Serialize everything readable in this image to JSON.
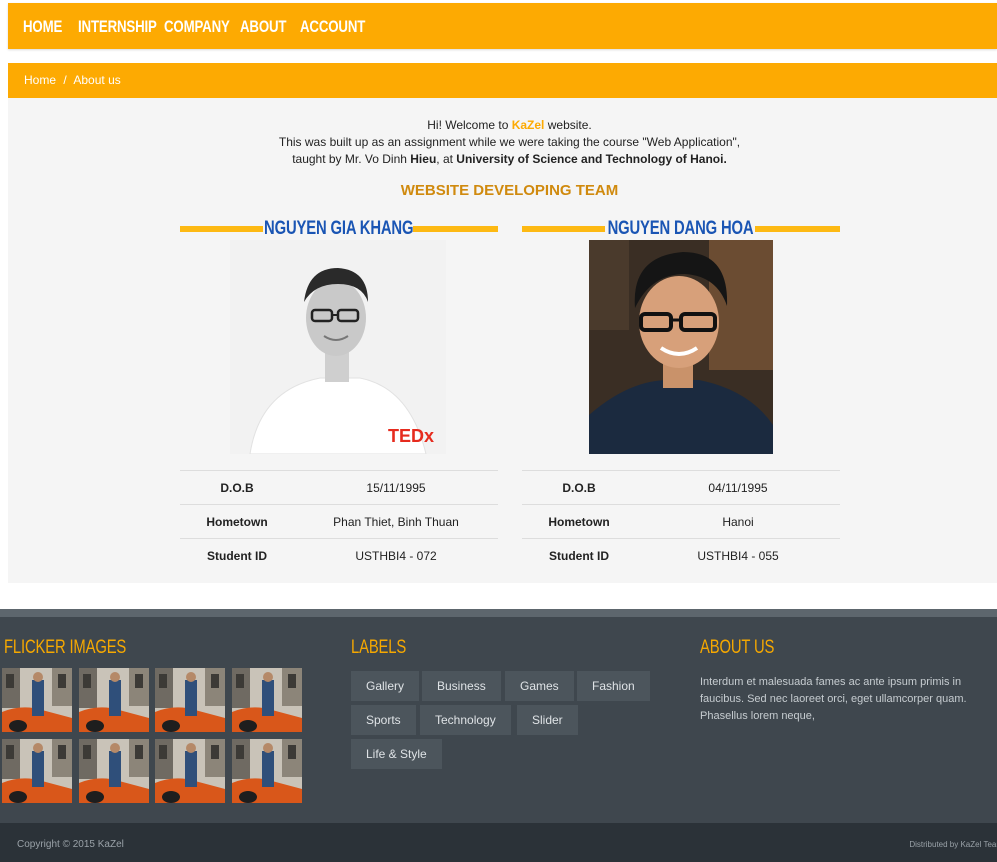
{
  "nav": {
    "items": [
      {
        "label": "HOME"
      },
      {
        "label": "INTERNSHIP"
      },
      {
        "label": "COMPANY"
      },
      {
        "label": "ABOUT"
      },
      {
        "label": "ACCOUNT"
      }
    ]
  },
  "breadcrumb": {
    "home": "Home",
    "separator": "/",
    "current": "About us"
  },
  "intro": {
    "line1_prefix": "Hi! Welcome to ",
    "line1_brand": "KaZel",
    "line1_suffix": " website.",
    "line2": "This was built up as an assignment while we were taking the course \"Web Application\",",
    "line3_prefix": "taught by Mr. Vo Dinh ",
    "line3_teacher": "Hieu",
    "line3_mid": ", at ",
    "line3_university": "University of Science and Technology of Hanoi."
  },
  "team_title": "WEBSITE DEVELOPING TEAM",
  "members": [
    {
      "name": "NGUYEN GIA KHANG",
      "photo_badge": "TEDx",
      "rows": [
        {
          "label": "D.O.B",
          "value": "15/11/1995"
        },
        {
          "label": "Hometown",
          "value": "Phan Thiet, Binh Thuan"
        },
        {
          "label": "Student ID",
          "value": "USTHBI4 - 072"
        }
      ]
    },
    {
      "name": "NGUYEN DANG HOA",
      "rows": [
        {
          "label": "D.O.B",
          "value": "04/11/1995"
        },
        {
          "label": "Hometown",
          "value": "Hanoi"
        },
        {
          "label": "Student ID",
          "value": "USTHBI4 - 055"
        }
      ]
    }
  ],
  "footer": {
    "flicker_title": "FLICKER IMAGES",
    "labels_title": "LABELS",
    "labels": [
      "Gallery",
      "Business",
      "Games",
      "Fashion",
      "Sports",
      "Technology",
      "Slider",
      "Life & Style"
    ],
    "about_title": "ABOUT US",
    "about_text": "Interdum et malesuada fames ac ante ipsum primis in faucibus. Sed nec laoreet orci, eget ullamcorper quam. Phasellus lorem neque,",
    "copyright": "Copyright © 2015 KaZel",
    "distributed": "Distributed by KaZel Team"
  },
  "colors": {
    "accent": "#fdaa02",
    "name_blue": "#1a55b4",
    "footer_bg": "#3f474e",
    "footer_title": "#f6a800"
  }
}
